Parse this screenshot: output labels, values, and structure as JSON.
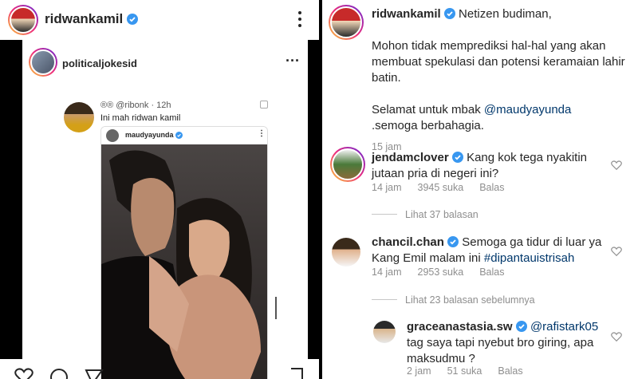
{
  "left": {
    "header": {
      "username": "ridwankamil"
    },
    "post": {
      "card_username": "politicaljokesid",
      "tweet_handle": "®® @ribonk · 12h",
      "tweet_text": "Ini mah ridwan kamil",
      "inner_username": "maudyayunda"
    }
  },
  "right": {
    "caption": {
      "username": "ridwankamil",
      "line1": "Netizen budiman,",
      "line2": "Mohon tidak memprediksi hal-hal yang akan membuat spekulasi dan potensi keramaian lahir batin.",
      "line3_pre": "Selamat untuk mbak ",
      "line3_mention": "@maudyayunda",
      "line3_post": ".semoga berbahagia.",
      "time": "15 jam"
    },
    "comments": [
      {
        "username": "jendamclover",
        "text": "Kang kok tega nyakitin jutaan pria di negeri ini?",
        "time": "14 jam",
        "likes": "3945 suka",
        "reply": "Balas",
        "thread": "Lihat 37 balasan"
      },
      {
        "username": "chancil.chan",
        "text_pre": "Semoga ga tidur di luar ya Kang Emil malam ini ",
        "hashtag": "#dipantauistrisah",
        "time": "14 jam",
        "likes": "2953 suka",
        "reply": "Balas",
        "thread": "Lihat 23 balasan sebelumnya"
      },
      {
        "username": "graceanastasia.sw",
        "mention": "@rafistark05",
        "text": "tag saya tapi nyebut bro giring, apa maksudmu ?",
        "time": "2 jam",
        "likes": "51 suka",
        "reply": "Balas"
      }
    ]
  },
  "colors": {
    "verified": "#3897f0",
    "link": "#00376b",
    "muted": "#8e8e8e"
  }
}
